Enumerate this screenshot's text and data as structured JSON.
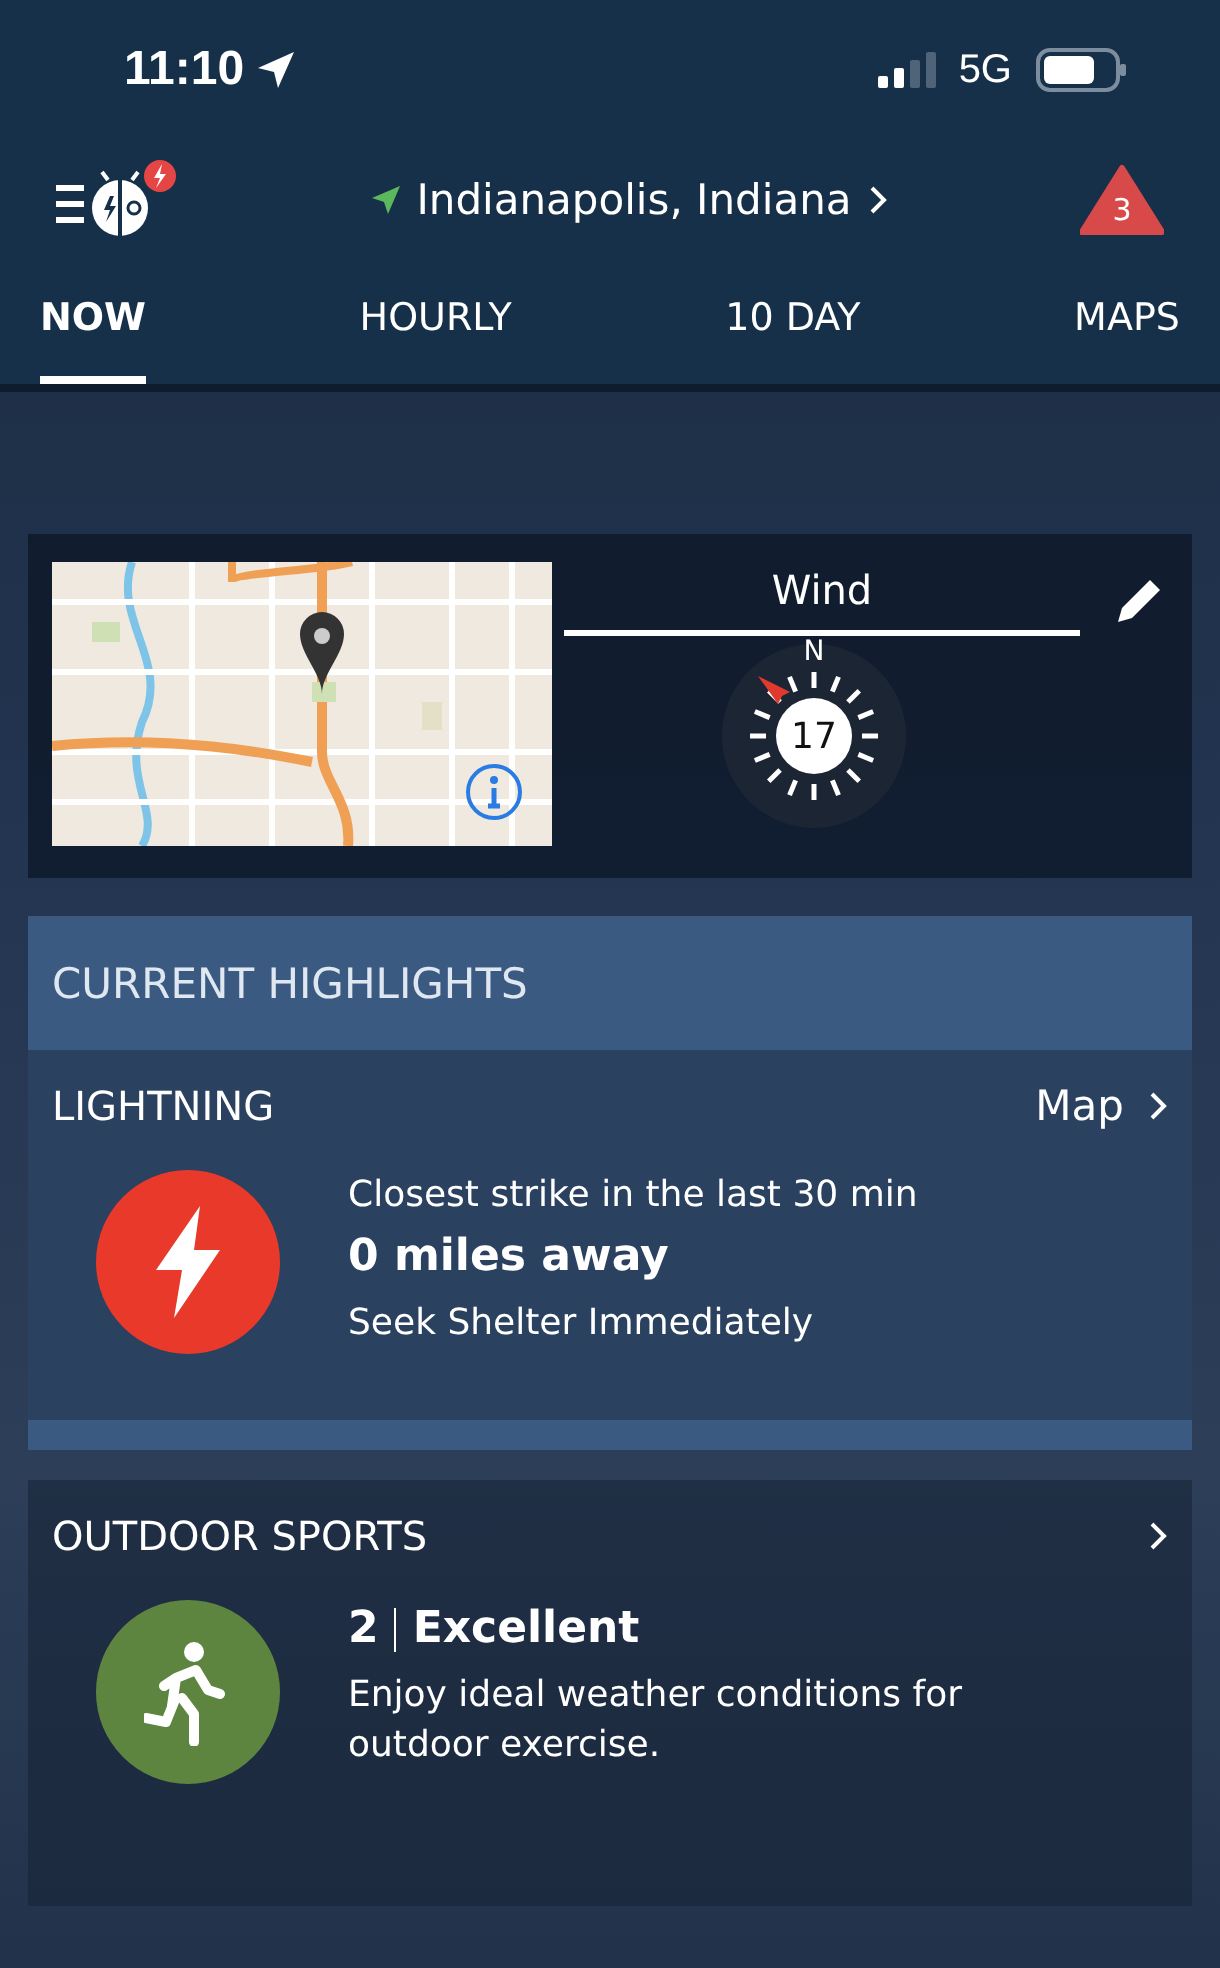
{
  "status_bar": {
    "time": "11:10",
    "network": "5G"
  },
  "header": {
    "location": "Indianapolis, Indiana",
    "alert_count": "3"
  },
  "tabs": [
    {
      "label": "NOW",
      "selected": true
    },
    {
      "label": "HOURLY",
      "selected": false
    },
    {
      "label": "10  DAY",
      "selected": false
    },
    {
      "label": "MAPS",
      "selected": false
    }
  ],
  "summary_card": {
    "title": "Wind",
    "compass": {
      "north_label": "N",
      "speed": "17"
    }
  },
  "highlights": {
    "title": "CURRENT HIGHLIGHTS"
  },
  "cards": [
    {
      "kind": "lightning",
      "title": "LIGHTNING",
      "link": "Map",
      "line1": "Closest strike in the last 30 min",
      "headline": "0 miles away",
      "detail": "Seek Shelter Immediately",
      "color": "#e8392a"
    },
    {
      "kind": "sports",
      "title": "OUTDOOR SPORTS",
      "score": "2",
      "rating": "Excellent",
      "detail": "Enjoy ideal weather conditions for outdoor exercise.",
      "color": "#5e8540"
    }
  ]
}
